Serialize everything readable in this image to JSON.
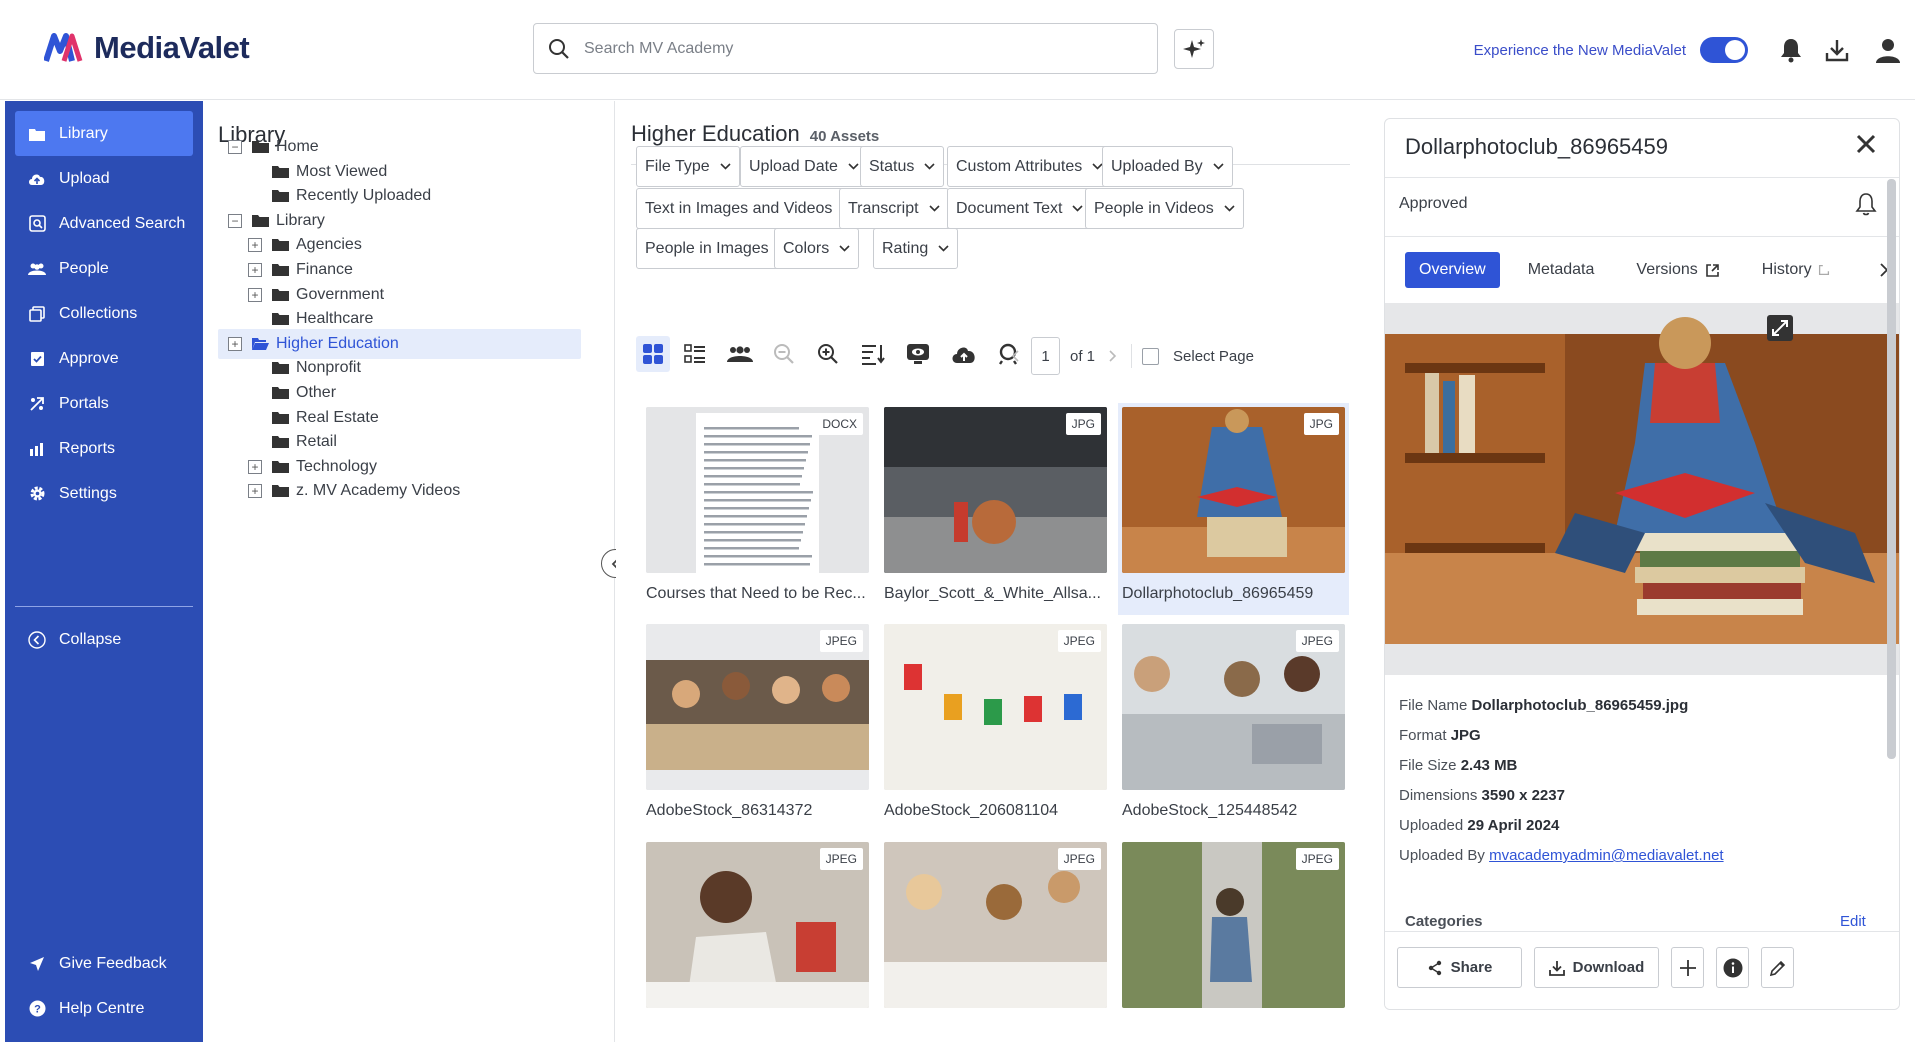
{
  "header": {
    "logo_text": "MediaValet",
    "search_placeholder": "Search MV Academy",
    "experience_label": "Experience the New MediaValet",
    "experience_toggle_on": true
  },
  "sidebar": {
    "items": [
      {
        "label": "Library",
        "icon": "folder-icon",
        "active": true
      },
      {
        "label": "Upload",
        "icon": "upload-cloud-icon"
      },
      {
        "label": "Advanced Search",
        "icon": "advanced-search-icon"
      },
      {
        "label": "People",
        "icon": "people-icon"
      },
      {
        "label": "Collections",
        "icon": "collections-icon"
      },
      {
        "label": "Approve",
        "icon": "approve-icon"
      },
      {
        "label": "Portals",
        "icon": "portals-icon"
      },
      {
        "label": "Reports",
        "icon": "reports-icon"
      },
      {
        "label": "Settings",
        "icon": "gear-icon"
      }
    ],
    "collapse_label": "Collapse",
    "feedback_label": "Give Feedback",
    "help_label": "Help Centre"
  },
  "tree": {
    "title": "Library",
    "items": [
      {
        "label": "Home",
        "expander": "minus"
      },
      {
        "label": "Most Viewed"
      },
      {
        "label": "Recently Uploaded"
      },
      {
        "label": "Library",
        "expander": "minus"
      },
      {
        "label": "Agencies",
        "expander": "plus"
      },
      {
        "label": "Finance",
        "expander": "plus"
      },
      {
        "label": "Government",
        "expander": "plus"
      },
      {
        "label": "Healthcare"
      },
      {
        "label": "Higher Education",
        "expander": "plus",
        "selected": true
      },
      {
        "label": "Nonprofit"
      },
      {
        "label": "Other"
      },
      {
        "label": "Real Estate"
      },
      {
        "label": "Retail"
      },
      {
        "label": "Technology",
        "expander": "plus"
      },
      {
        "label": "z. MV Academy Videos",
        "expander": "plus"
      }
    ]
  },
  "main": {
    "title": "Higher Education",
    "count": "40 Assets",
    "filters": [
      "File Type",
      "Upload Date",
      "Status",
      "Custom Attributes",
      "Uploaded By",
      "Text in Images and Videos",
      "Transcript",
      "Document Text",
      "People in Videos",
      "People in Images",
      "Colors",
      "Rating"
    ],
    "pager": {
      "page": "1",
      "of": "of 1",
      "select_page": "Select Page"
    },
    "assets": [
      {
        "name": "Courses that Need to be Rec...",
        "type": "DOCX"
      },
      {
        "name": "Baylor_Scott_&_White_Allsa...",
        "type": "JPG"
      },
      {
        "name": "Dollarphotoclub_86965459",
        "type": "JPG",
        "selected": true
      },
      {
        "name": "AdobeStock_86314372",
        "type": "JPEG"
      },
      {
        "name": "AdobeStock_206081104",
        "type": "JPEG"
      },
      {
        "name": "AdobeStock_125448542",
        "type": "JPEG"
      },
      {
        "name": "",
        "type": "JPEG"
      },
      {
        "name": "",
        "type": "JPEG"
      },
      {
        "name": "",
        "type": "JPEG"
      }
    ]
  },
  "detail": {
    "title": "Dollarphotoclub_86965459",
    "status": "Approved",
    "tabs": [
      "Overview",
      "Metadata",
      "Versions",
      "History"
    ],
    "meta": [
      {
        "label": "File Name",
        "value": "Dollarphotoclub_86965459.jpg"
      },
      {
        "label": "Format",
        "value": "JPG"
      },
      {
        "label": "File Size",
        "value": "2.43 MB"
      },
      {
        "label": "Dimensions",
        "value": "3590 x 2237"
      },
      {
        "label": "Uploaded",
        "value": "29 April 2024"
      },
      {
        "label": "Uploaded By",
        "value": "mvacademyadmin@mediavalet.net"
      }
    ],
    "categories_label": "Categories",
    "edit_label": "Edit",
    "share_label": "Share",
    "download_label": "Download"
  },
  "colors": {
    "sidebar": "#2c4db4",
    "sidebar_active": "#4d78f0",
    "accent": "#2f54d6"
  }
}
